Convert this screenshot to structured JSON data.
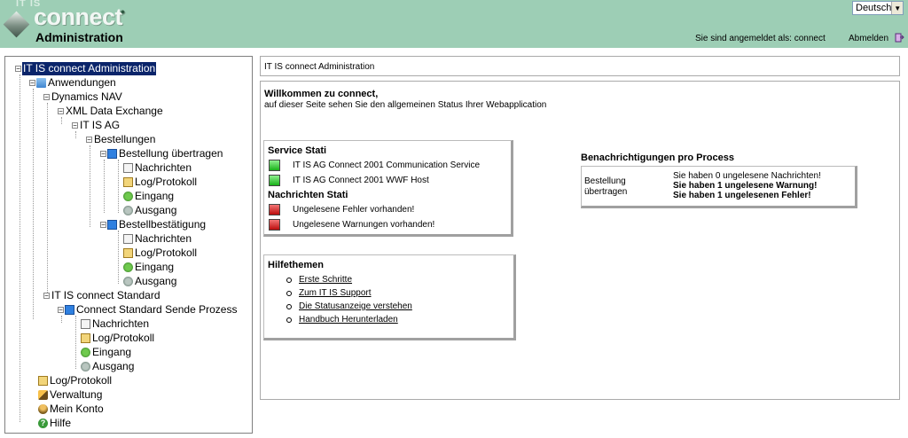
{
  "header": {
    "brand_top": "IT IS",
    "brand_main": "connect",
    "brand_sub": "Administration",
    "language": "Deutsch",
    "logged_in_as": "Sie sind angemeldet als: connect",
    "logout": "Abmelden"
  },
  "tree": {
    "root": "IT IS connect Administration",
    "anwendungen": "Anwendungen",
    "dynamics": "Dynamics NAV",
    "xml": "XML Data Exchange",
    "itisag": "IT IS AG",
    "bestellungen": "Bestellungen",
    "bestellung_uebertragen": "Bestellung übertragen",
    "bestellbestaetigung": "Bestellbestätigung",
    "standard": "IT IS connect Standard",
    "sende_prozess": "Connect Standard Sende Prozess",
    "nachrichten": "Nachrichten",
    "log": "Log/Protokoll",
    "eingang": "Eingang",
    "ausgang": "Ausgang",
    "verwaltung": "Verwaltung",
    "konto": "Mein Konto",
    "hilfe": "Hilfe"
  },
  "content": {
    "breadcrumb": "IT IS connect Administration",
    "welcome_title": "Willkommen zu connect,",
    "welcome_sub": "auf dieser Seite sehen Sie den allgemeinen Status Ihrer Webapplication",
    "service_title": "Service Stati",
    "services": [
      {
        "label": "IT IS AG Connect 2001 Communication Service",
        "status": "green"
      },
      {
        "label": "IT IS AG Connect 2001 WWF Host",
        "status": "green"
      }
    ],
    "message_title": "Nachrichten Stati",
    "messages": [
      {
        "label": "Ungelesene Fehler vorhanden!",
        "status": "red"
      },
      {
        "label": "Ungelesene Warnungen vorhanden!",
        "status": "red"
      }
    ],
    "help_title": "Hilfethemen",
    "help_links": [
      "Erste Schritte",
      "Zum IT IS Support",
      "Die Statusanzeige verstehen",
      "Handbuch Herunterladen"
    ],
    "notif_title": "Benachrichtigungen pro Process",
    "notif_process": "Bestellung übertragen",
    "notif_lines": [
      "Sie haben 0 ungelesene Nachrichten!",
      "Sie haben 1 ungelesene Warnung!",
      "Sie haben 1 ungelesenen Fehler!"
    ]
  },
  "colors": {
    "header_bg": "#9dceb5",
    "selection": "#0a246a",
    "status_green": "#19b219",
    "status_red": "#bb0d0d"
  }
}
